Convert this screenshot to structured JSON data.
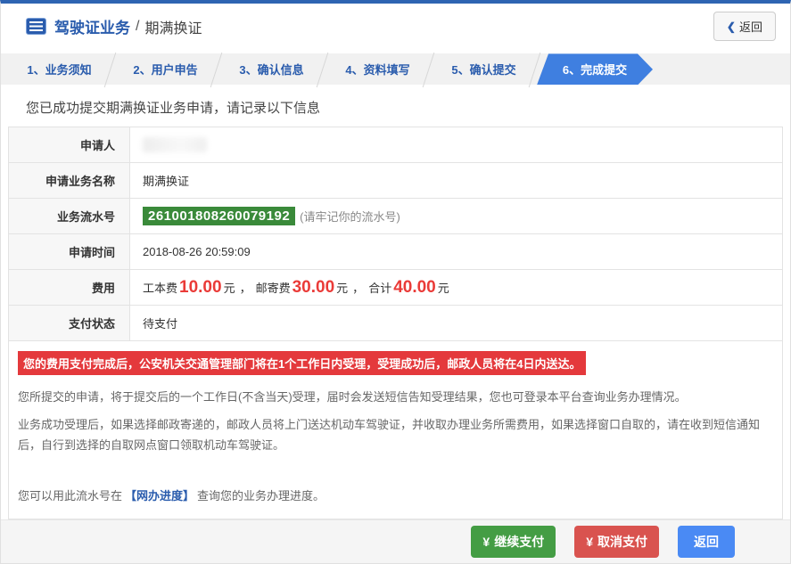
{
  "colors": {
    "top_accent": "#2e64b2",
    "link_blue": "#2a5cad",
    "active_step_blue": "#3f7fe0",
    "serial_green": "#3a8a3a",
    "warning_red": "#e4393c",
    "price_red": "#ea3b38",
    "btn_green": "#449d44",
    "btn_red": "#d9534f",
    "btn_blue": "#4a8af4"
  },
  "header": {
    "section_title": "驾驶证业务",
    "separator": "/",
    "page_title": "期满换证",
    "back_chevron": "❮",
    "back_label": "返回"
  },
  "steps": {
    "items": [
      {
        "label": "1、业务须知"
      },
      {
        "label": "2、用户申告"
      },
      {
        "label": "3、确认信息"
      },
      {
        "label": "4、资料填写"
      },
      {
        "label": "5、确认提交"
      },
      {
        "label": "6、完成提交"
      }
    ],
    "active_index": 5
  },
  "result": {
    "success_message": "您已成功提交期满换证业务申请，请记录以下信息"
  },
  "table": {
    "applicant_label": "申请人",
    "business_label": "申请业务名称",
    "business_value": "期满换证",
    "serial_label": "业务流水号",
    "serial_number": "261001808260079192",
    "serial_note": "(请牢记你的流水号)",
    "time_label": "申请时间",
    "time_value": "2018-08-26 20:59:09",
    "fee_label": "费用",
    "fee": {
      "work_label": "工本费",
      "work_amount": "10.00",
      "post_label": "邮寄费",
      "post_amount": "30.00",
      "total_label": "合计",
      "total_amount": "40.00",
      "unit": "元",
      "separator": "，"
    },
    "status_label": "支付状态",
    "status_value": "待支付"
  },
  "notice": {
    "warning": "您的费用支付完成后，公安机关交通管理部门将在1个工作日内受理，受理成功后，邮政人员将在4日内送达。",
    "p1": "您所提交的申请，将于提交后的一个工作日(不含当天)受理，届时会发送短信告知受理结果，您也可登录本平台查询业务办理情况。",
    "p2": "业务成功受理后，如果选择邮政寄递的，邮政人员将上门送达机动车驾驶证，并收取办理业务所需费用，如果选择窗口自取的，请在收到短信通知后，自行到选择的自取网点窗口领取机动车驾驶证。",
    "progress_prefix": "您可以用此流水号在",
    "progress_link": "【网办进度】",
    "progress_suffix": "查询您的业务办理进度。"
  },
  "footer": {
    "continue_icon": "¥",
    "continue_label": "继续支付",
    "cancel_icon": "¥",
    "cancel_label": "取消支付",
    "back_label": "返回"
  }
}
